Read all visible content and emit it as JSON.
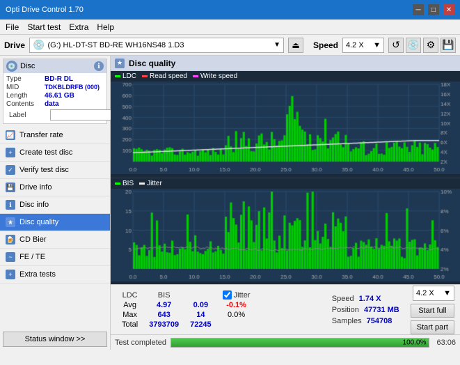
{
  "titlebar": {
    "title": "Opti Drive Control 1.70",
    "min_label": "─",
    "max_label": "□",
    "close_label": "✕"
  },
  "menubar": {
    "items": [
      "File",
      "Start test",
      "Extra",
      "Help"
    ]
  },
  "drivebar": {
    "label": "Drive",
    "drive_value": "(G:)  HL-DT-ST BD-RE  WH16NS48 1.D3",
    "speed_label": "Speed",
    "speed_value": "4.2 X"
  },
  "sidebar": {
    "disc_header": "Disc",
    "disc_fields": [
      {
        "key": "Type",
        "value": "BD-R DL",
        "colored": true
      },
      {
        "key": "MID",
        "value": "TDKBLDRFB (000)",
        "colored": true
      },
      {
        "key": "Length",
        "value": "46.61 GB",
        "colored": true
      },
      {
        "key": "Contents",
        "value": "data",
        "colored": true
      },
      {
        "key": "Label",
        "value": "",
        "colored": false
      }
    ],
    "nav_items": [
      {
        "id": "transfer-rate",
        "label": "Transfer rate",
        "active": false
      },
      {
        "id": "create-test-disc",
        "label": "Create test disc",
        "active": false
      },
      {
        "id": "verify-test-disc",
        "label": "Verify test disc",
        "active": false
      },
      {
        "id": "drive-info",
        "label": "Drive info",
        "active": false
      },
      {
        "id": "disc-info",
        "label": "Disc info",
        "active": false
      },
      {
        "id": "disc-quality",
        "label": "Disc quality",
        "active": true
      },
      {
        "id": "cd-bier",
        "label": "CD Bier",
        "active": false
      },
      {
        "id": "fe-te",
        "label": "FE / TE",
        "active": false
      },
      {
        "id": "extra-tests",
        "label": "Extra tests",
        "active": false
      }
    ],
    "status_btn": "Status window >>"
  },
  "quality_panel": {
    "title": "Disc quality",
    "legend_top": [
      {
        "label": "LDC",
        "color": "#ffffff"
      },
      {
        "label": "Read speed",
        "color": "#ff4444"
      },
      {
        "label": "Write speed",
        "color": "#ff44ff"
      }
    ],
    "legend_bottom": [
      {
        "label": "BIS",
        "color": "#ffffff"
      },
      {
        "label": "Jitter",
        "color": "#ffffff"
      }
    ],
    "chart_top": {
      "y_max": 700,
      "y_labels": [
        "700",
        "600",
        "500",
        "400",
        "300",
        "200",
        "100"
      ],
      "x_labels": [
        "0.0",
        "5.0",
        "10.0",
        "15.0",
        "20.0",
        "25.0",
        "30.0",
        "35.0",
        "40.0",
        "45.0",
        "50.0 GB"
      ],
      "right_labels": [
        "18X",
        "16X",
        "14X",
        "12X",
        "10X",
        "8X",
        "6X",
        "4X",
        "2X"
      ]
    },
    "chart_bottom": {
      "y_max": 20,
      "y_labels": [
        "20",
        "15",
        "10",
        "5"
      ],
      "x_labels": [
        "0.0",
        "5.0",
        "10.0",
        "15.0",
        "20.0",
        "25.0",
        "30.0",
        "35.0",
        "40.0",
        "45.0",
        "50.0 GB"
      ],
      "right_labels": [
        "10%",
        "8%",
        "6%",
        "4%",
        "2%"
      ]
    }
  },
  "stats": {
    "headers": [
      "LDC",
      "BIS",
      "",
      "Jitter",
      "Speed",
      ""
    ],
    "avg": {
      "ldc": "4.97",
      "bis": "0.09",
      "jitter": "-0.1%",
      "speed_label": "1.74 X"
    },
    "max": {
      "ldc": "643",
      "bis": "14",
      "jitter": "0.0%"
    },
    "total": {
      "ldc": "3793709",
      "bis": "72245"
    },
    "jitter_checked": true,
    "jitter_label": "Jitter",
    "position_label": "Position",
    "position_value": "47731 MB",
    "samples_label": "Samples",
    "samples_value": "754708",
    "speed_select": "4.2 X",
    "start_full": "Start full",
    "start_part": "Start part"
  },
  "progress": {
    "status_label": "Test completed",
    "percent": 100,
    "percent_text": "100.0%",
    "right_text": "63:06"
  }
}
